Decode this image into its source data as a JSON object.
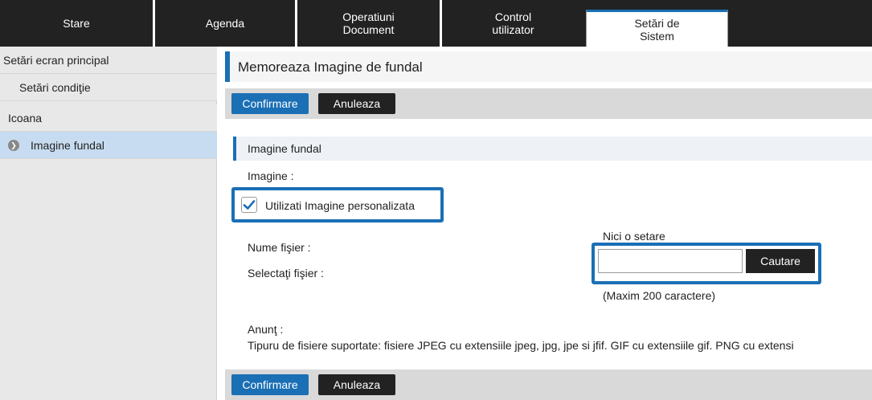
{
  "tabs": [
    {
      "label": "Stare"
    },
    {
      "label": "Agenda"
    },
    {
      "label": "Operatiuni\nDocument"
    },
    {
      "label": "Control\nutilizator"
    },
    {
      "label": "Setări de\nSistem"
    }
  ],
  "sidebar": {
    "items": [
      {
        "label": "Setări ecran principal"
      },
      {
        "label": "Setări condiţie"
      },
      {
        "label": "Icoana"
      },
      {
        "label": "Imagine fundal"
      }
    ]
  },
  "main": {
    "title": "Memoreaza Imagine de fundal",
    "confirm_label": "Confirmare",
    "cancel_label": "Anuleaza",
    "section_title": "Imagine fundal",
    "image_label": "Imagine :",
    "checkbox_label": "Utilizati Imagine personalizata",
    "checkbox_checked": true,
    "filename_label": "Nume fişier :",
    "filename_value": "Nici o setare",
    "select_label": "Selectaţi fişier :",
    "browse_label": "Cautare",
    "file_input_value": "",
    "max_chars_note": "(Maxim 200 caractere)",
    "notice_label": "Anunţ :",
    "notice_text": "Tipuru de fisiere suportate: fisiere JPEG cu extensiile jpeg, jpg, jpe si jfif. GIF cu extensiile gif. PNG cu extensi"
  },
  "colors": {
    "accent": "#1a6fb5",
    "dark": "#222222",
    "sidebar_active": "#c7dcf0"
  }
}
